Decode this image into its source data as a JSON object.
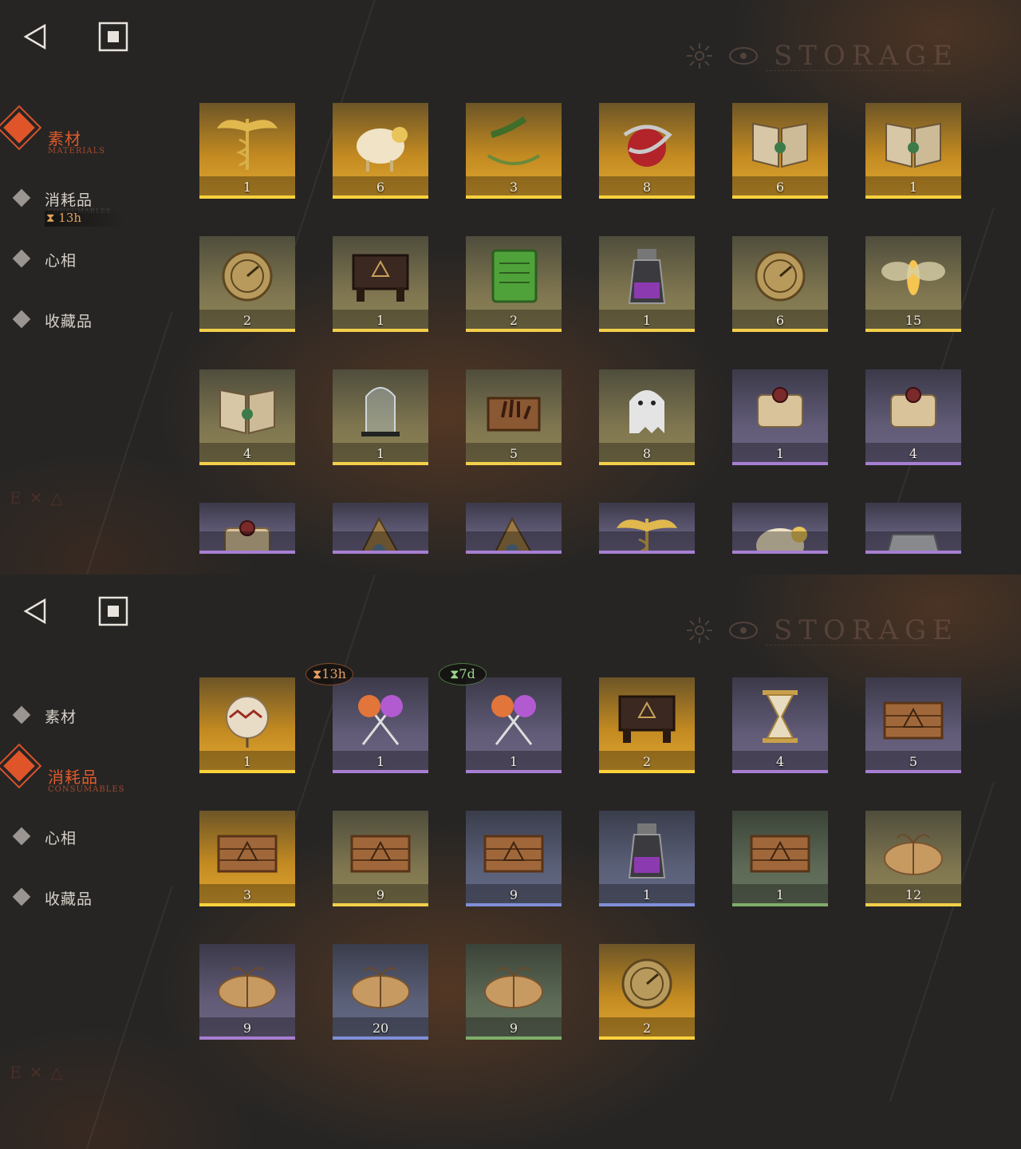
{
  "watermark": {
    "text": "STORAGE"
  },
  "nav": {
    "items": [
      {
        "label": "素材",
        "sub": "MATERIALS"
      },
      {
        "label": "消耗品",
        "sub": "CONSUMABLES"
      },
      {
        "label": "心相",
        "sub": ""
      },
      {
        "label": "收藏品",
        "sub": ""
      }
    ],
    "consumables_timer": "⧗ 13h"
  },
  "materials_panel": {
    "active_tab": "素材",
    "items": [
      {
        "icon": "winged-caduceus-icon",
        "count": "1",
        "quality": "gold"
      },
      {
        "icon": "sheep-figurine-icon",
        "count": "6",
        "quality": "gold"
      },
      {
        "icon": "laurel-wreath-icon",
        "count": "3",
        "quality": "gold"
      },
      {
        "icon": "snake-apple-icon",
        "count": "8",
        "quality": "gold"
      },
      {
        "icon": "open-book-green-emblem-icon",
        "count": "6",
        "quality": "gold"
      },
      {
        "icon": "open-book-gold-emblem-icon",
        "count": "1",
        "quality": "gold"
      },
      {
        "icon": "astrolabe-icon",
        "count": "2",
        "quality": "olive"
      },
      {
        "icon": "ouija-board-icon",
        "count": "1",
        "quality": "olive"
      },
      {
        "icon": "green-tablet-icon",
        "count": "2",
        "quality": "olive"
      },
      {
        "icon": "purple-potion-bottle-icon",
        "count": "1",
        "quality": "olive"
      },
      {
        "icon": "pocket-watch-icon",
        "count": "6",
        "quality": "olive"
      },
      {
        "icon": "glowing-moth-icon",
        "count": "15",
        "quality": "olive"
      },
      {
        "icon": "dark-tome-icon",
        "count": "4",
        "quality": "olive"
      },
      {
        "icon": "bell-jar-icon",
        "count": "1",
        "quality": "olive"
      },
      {
        "icon": "hand-in-box-icon",
        "count": "5",
        "quality": "olive"
      },
      {
        "icon": "ghost-sheet-icon",
        "count": "8",
        "quality": "olive"
      },
      {
        "icon": "scroll-red-seal-icon",
        "count": "1",
        "quality": "purple"
      },
      {
        "icon": "scroll-green-seal-icon",
        "count": "4",
        "quality": "purple"
      },
      {
        "icon": "scroll-icon",
        "count": "",
        "quality": "purple"
      },
      {
        "icon": "chain-relic-icon",
        "count": "",
        "quality": "purple"
      },
      {
        "icon": "metal-shard-icon",
        "count": "",
        "quality": "purple"
      },
      {
        "icon": "winged-key-icon",
        "count": "",
        "quality": "purple"
      },
      {
        "icon": "bird-figurine-icon",
        "count": "",
        "quality": "purple"
      },
      {
        "icon": "silver-ingot-icon",
        "count": "",
        "quality": "purple"
      }
    ]
  },
  "consumables_panel": {
    "active_tab": "消耗品",
    "items": [
      {
        "icon": "gourd-charm-icon",
        "count": "1",
        "quality": "gold",
        "timer": ""
      },
      {
        "icon": "crossed-lollipops-icon",
        "count": "1",
        "quality": "purple",
        "timer": "⧗13h",
        "timer_color": "orange"
      },
      {
        "icon": "crossed-lollipops-icon",
        "count": "1",
        "quality": "purple",
        "timer": "⧗7d",
        "timer_color": "green"
      },
      {
        "icon": "rune-table-icon",
        "count": "2",
        "quality": "gold",
        "timer": ""
      },
      {
        "icon": "hourglass-icon",
        "count": "4",
        "quality": "purple",
        "timer": ""
      },
      {
        "icon": "wooden-crate-icon",
        "count": "5",
        "quality": "purple",
        "timer": ""
      },
      {
        "icon": "wooden-crate-icon",
        "count": "3",
        "quality": "gold",
        "timer": ""
      },
      {
        "icon": "wooden-crate-icon",
        "count": "9",
        "quality": "olive",
        "timer": ""
      },
      {
        "icon": "wooden-crate-icon",
        "count": "9",
        "quality": "blue",
        "timer": ""
      },
      {
        "icon": "bottle-with-notes-icon",
        "count": "1",
        "quality": "blue",
        "timer": ""
      },
      {
        "icon": "wooden-crate-icon",
        "count": "1",
        "quality": "green",
        "timer": ""
      },
      {
        "icon": "cloth-bundle-icon",
        "count": "12",
        "quality": "olive",
        "timer": ""
      },
      {
        "icon": "cloth-bundle-icon",
        "count": "9",
        "quality": "purple",
        "timer": ""
      },
      {
        "icon": "cloth-bundle-icon",
        "count": "20",
        "quality": "blue",
        "timer": ""
      },
      {
        "icon": "cloth-bundle-icon",
        "count": "9",
        "quality": "green",
        "timer": ""
      },
      {
        "icon": "octagon-medallion-icon",
        "count": "2",
        "quality": "gold",
        "timer": ""
      }
    ]
  }
}
